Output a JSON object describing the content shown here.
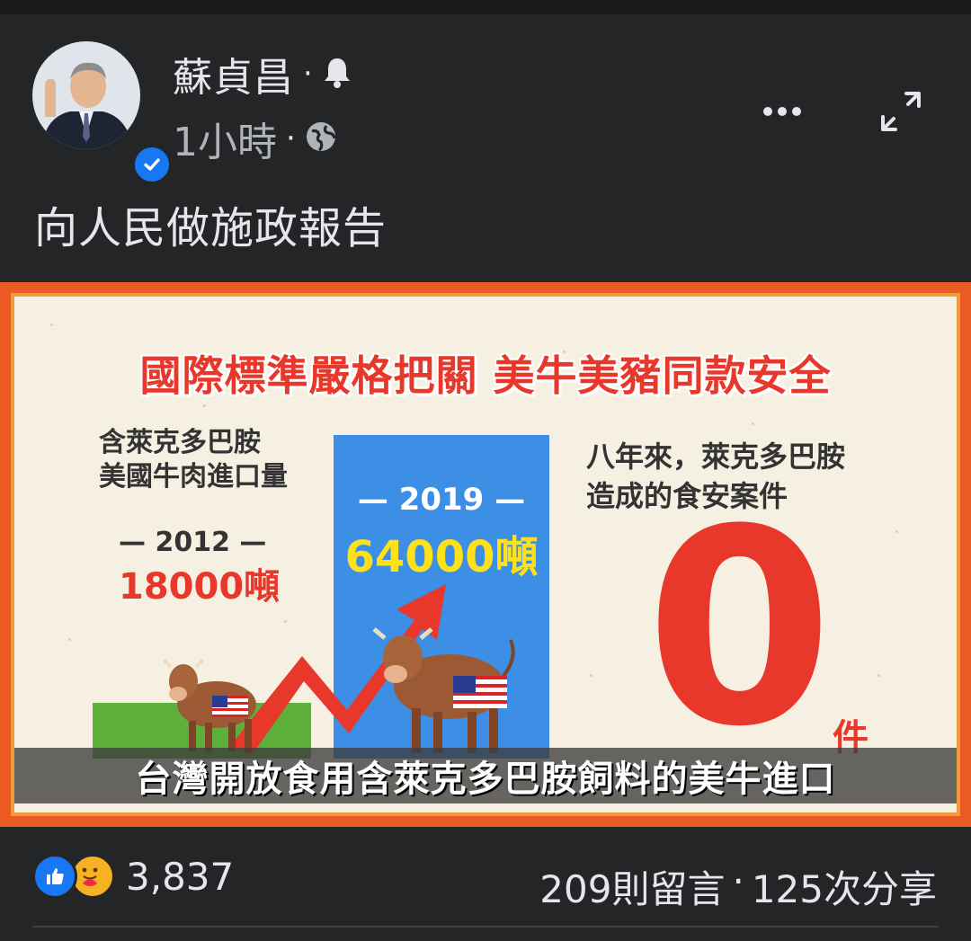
{
  "post": {
    "author": "蘇貞昌",
    "time": "1小時",
    "caption": "向人民做施政報告"
  },
  "infographic": {
    "title": "國際標準嚴格把關  美牛美豬同款安全",
    "left_label_line1": "含萊克多巴胺",
    "left_label_line2": "美國牛肉進口量",
    "year_2012": "— 2012 —",
    "value_2012": "18000噸",
    "year_2019": "— 2019 —",
    "value_2019": "64000噸",
    "right_label_line1": "八年來，萊克多巴胺",
    "right_label_line2": "造成的食安案件",
    "zero_value": "0",
    "zero_unit": "件",
    "subtitle": "台灣開放食用含萊克多巴胺飼料的美牛進口"
  },
  "stats": {
    "reactions_count": "3,837",
    "comments": "209則留言",
    "shares": "125次分享"
  },
  "colors": {
    "background": "#242526",
    "accent_red": "#e8382c",
    "brand_blue": "#1877f2",
    "bar_blue": "#3d8ee5",
    "bar_green": "#5cb03b",
    "frame_orange": "#ec5a24"
  }
}
